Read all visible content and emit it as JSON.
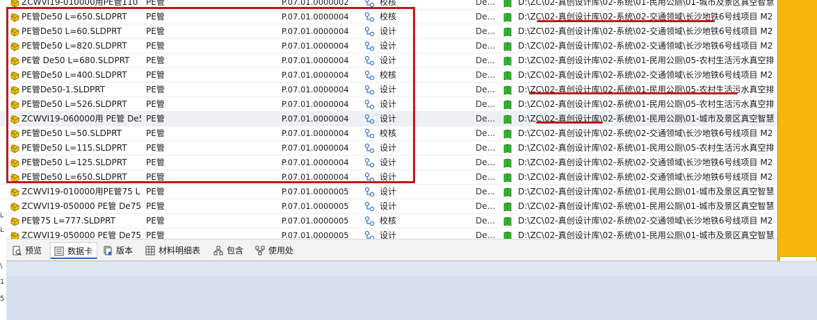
{
  "rows": [
    {
      "name": "ZCWVI19-010000用PE管110  L...",
      "type": "PE管",
      "code": "P.07.01.0000002",
      "state": "校核",
      "de": "De...",
      "path": "D:\\ZC\\02-真创设计库\\02-系统\\01-民用公厕\\01-城市及景区真空智慧"
    },
    {
      "name": "PE管De50  L=650.SLDPRT",
      "type": "PE管",
      "code": "P.07.01.0000004",
      "state": "校核",
      "de": "De...",
      "path": "D:\\ZC\\02-真创设计库\\02-系统\\02-交通领域\\长沙地铁6号线项目 M2"
    },
    {
      "name": "PE管De50  L=60.SLDPRT",
      "type": "PE管",
      "code": "P.07.01.0000004",
      "state": "设计",
      "de": "De...",
      "path": "D:\\ZC\\02-真创设计库\\02-系统\\02-交通领域\\长沙地铁6号线项目 M2"
    },
    {
      "name": "PE管De50  L=820.SLDPRT",
      "type": "PE管",
      "code": "P.07.01.0000004",
      "state": "设计",
      "de": "De...",
      "path": "D:\\ZC\\02-真创设计库\\02-系统\\02-交通领域\\长沙地铁6号线项目 M2"
    },
    {
      "name": "PE管 De50  L=680.SLDPRT",
      "type": "PE管",
      "code": "P.07.01.0000004",
      "state": "设计",
      "de": "De...",
      "path": "D:\\ZC\\02-真创设计库\\02-系统\\01-民用公厕\\05-农村生活污水真空排"
    },
    {
      "name": "PE管De50  L=400.SLDPRT",
      "type": "PE管",
      "code": "P.07.01.0000004",
      "state": "校核",
      "de": "De...",
      "path": "D:\\ZC\\02-真创设计库\\02-系统\\02-交通领域\\长沙地铁6号线项目 M2"
    },
    {
      "name": "PE管De50-1.SLDPRT",
      "type": "PE管",
      "code": "P.07.01.0000004",
      "state": "设计",
      "de": "De...",
      "path": "D:\\ZC\\02-真创设计库\\02-系统\\01-民用公厕\\05-农村生活污水真空排"
    },
    {
      "name": "PE管De50  L=526.SLDPRT",
      "type": "PE管",
      "code": "P.07.01.0000004",
      "state": "设计",
      "de": "De...",
      "path": "D:\\ZC\\02-真创设计库\\02-系统\\01-民用公厕\\05-农村生活污水真空排"
    },
    {
      "name": "ZCWVI19-060000用 PE管 De50...",
      "type": "PE管",
      "code": "P.07.01.0000004",
      "state": "设计",
      "de": "De...",
      "path": "D:\\ZC\\02-真创设计库\\02-系统\\01-民用公厕\\01-城市及景区真空智慧"
    },
    {
      "name": "PE管De50  L=50.SLDPRT",
      "type": "PE管",
      "code": "P.07.01.0000004",
      "state": "校核",
      "de": "De...",
      "path": "D:\\ZC\\02-真创设计库\\02-系统\\02-交通领域\\长沙地铁6号线项目 M2"
    },
    {
      "name": "PE管De50  L=115.SLDPRT",
      "type": "PE管",
      "code": "P.07.01.0000004",
      "state": "设计",
      "de": "De...",
      "path": "D:\\ZC\\02-真创设计库\\02-系统\\01-民用公厕\\05-农村生活污水真空排"
    },
    {
      "name": "PE管De50  L=125.SLDPRT",
      "type": "PE管",
      "code": "P.07.01.0000004",
      "state": "设计",
      "de": "De...",
      "path": "D:\\ZC\\02-真创设计库\\02-系统\\02-交通领域\\长沙地铁6号线项目 M2"
    },
    {
      "name": "PE管De50   L=650.SLDPRT",
      "type": "PE管",
      "code": "P.07.01.0000004",
      "state": "设计",
      "de": "De...",
      "path": "D:\\ZC\\02-真创设计库\\02-系统\\02-交通领域\\长沙地铁6号线项目 M2"
    },
    {
      "name": "ZCWVI19-010000用PE管75   L...",
      "type": "PE管",
      "code": "P.07.01.0000005",
      "state": "设计",
      "de": "De...",
      "path": "D:\\ZC\\02-真创设计库\\02-系统\\01-民用公厕\\01-城市及景区真空智慧"
    },
    {
      "name": "ZCWVI19-050000 PE管 De75 L...",
      "type": "PE管",
      "code": "P.07.01.0000005",
      "state": "设计",
      "de": "De...",
      "path": "D:\\ZC\\02-真创设计库\\02-系统\\01-民用公厕\\01-城市及景区真空智慧"
    },
    {
      "name": "PE管75   L=777.SLDPRT",
      "type": "PE管",
      "code": "P.07.01.0000005",
      "state": "校核",
      "de": "De...",
      "path": "D:\\ZC\\02-真创设计库\\02-系统\\02-交通领域\\长沙地铁6号线项目 M2"
    },
    {
      "name": "ZCWVI19-050000 PE管 De75 L...",
      "type": "PE管",
      "code": "P.07.01.0000005",
      "state": "设计",
      "de": "De...",
      "path": "D:\\ZC\\02-真创设计库\\02-系统\\01-民用公厕\\01-城市及景区真空智慧"
    }
  ],
  "tabs": [
    {
      "label": "预览",
      "icon": "preview-icon"
    },
    {
      "label": "数据卡",
      "icon": "datacard-icon"
    },
    {
      "label": "版本",
      "icon": "version-icon"
    },
    {
      "label": "材料明细表",
      "icon": "bom-table-icon"
    },
    {
      "label": "包含",
      "icon": "contains-icon"
    },
    {
      "label": "使用处",
      "icon": "where-used-icon"
    }
  ],
  "active_tab": "数据卡",
  "gutter_marks": [
    "L",
    "L",
    "\\",
    "1",
    "5"
  ],
  "colors": {
    "highlight": "#c0171c",
    "side_panel": "#f5b70b",
    "bottom_area": "#dfe7f2"
  }
}
